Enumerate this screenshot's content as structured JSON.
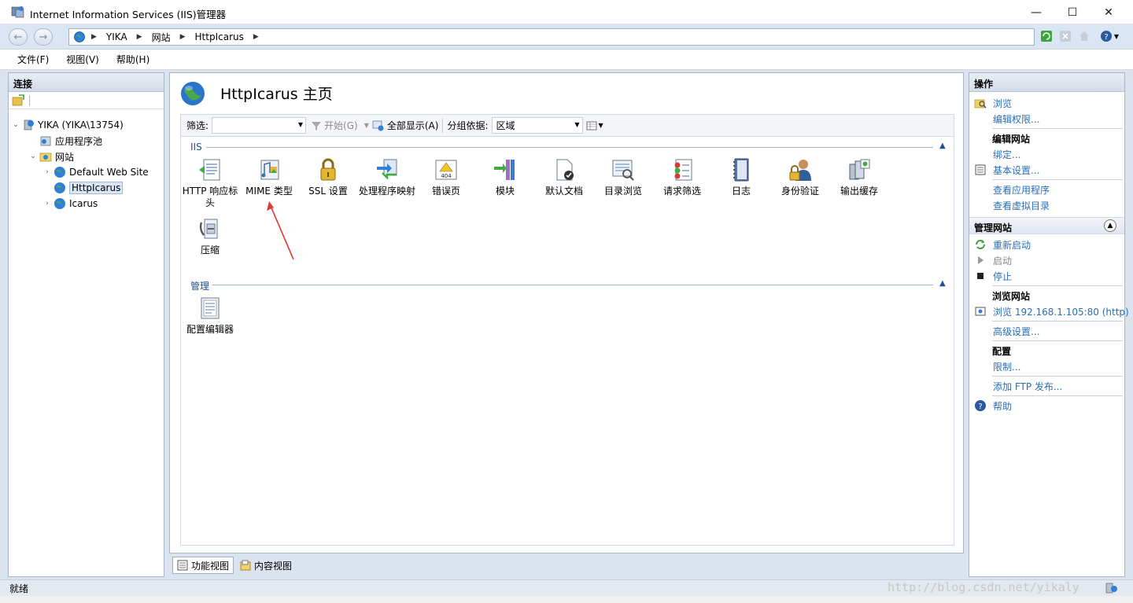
{
  "window": {
    "title": "Internet Information Services (IIS)管理器",
    "minimize": "—",
    "maximize": "☐",
    "close": "✕"
  },
  "address": {
    "crumbs": [
      "YIKA",
      "网站",
      "HttpIcarus"
    ]
  },
  "menu": [
    "文件(F)",
    "视图(V)",
    "帮助(H)"
  ],
  "connections": {
    "header": "连接",
    "tree": [
      {
        "label": "YIKA (YIKA\\13754)",
        "level": 0,
        "expander": "⌄"
      },
      {
        "label": "应用程序池",
        "level": 1,
        "expander": ""
      },
      {
        "label": "网站",
        "level": 1,
        "expander": "⌄"
      },
      {
        "label": "Default Web Site",
        "level": 2,
        "expander": "›"
      },
      {
        "label": "HttpIcarus",
        "level": 2,
        "expander": "",
        "selected": true
      },
      {
        "label": "Icarus",
        "level": 2,
        "expander": "›"
      }
    ]
  },
  "center": {
    "title": "HttpIcarus 主页",
    "filter_label": "筛选:",
    "filter_value": "",
    "start_label": "开始(G)",
    "show_all_label": "全部显示(A)",
    "group_by_label": "分组依据:",
    "group_by_value": "区域",
    "groups": [
      {
        "name": "IIS",
        "features": [
          {
            "label": "HTTP 响应标头",
            "icon": "http-response-headers-icon"
          },
          {
            "label": "MIME 类型",
            "icon": "mime-types-icon"
          },
          {
            "label": "SSL 设置",
            "icon": "ssl-lock-icon"
          },
          {
            "label": "处理程序映射",
            "icon": "handler-mappings-icon"
          },
          {
            "label": "错误页",
            "icon": "error-pages-404-icon"
          },
          {
            "label": "模块",
            "icon": "modules-icon"
          },
          {
            "label": "默认文档",
            "icon": "default-document-icon"
          },
          {
            "label": "目录浏览",
            "icon": "directory-browsing-icon"
          },
          {
            "label": "请求筛选",
            "icon": "request-filtering-icon"
          },
          {
            "label": "日志",
            "icon": "logging-icon"
          },
          {
            "label": "身份验证",
            "icon": "authentication-icon"
          },
          {
            "label": "输出缓存",
            "icon": "output-caching-icon"
          },
          {
            "label": "压缩",
            "icon": "compression-icon"
          }
        ]
      },
      {
        "name": "管理",
        "features": [
          {
            "label": "配置编辑器",
            "icon": "configuration-editor-icon"
          }
        ]
      }
    ],
    "tabs": [
      {
        "label": "功能视图",
        "active": true
      },
      {
        "label": "内容视图",
        "active": false
      }
    ]
  },
  "actions": {
    "header": "操作",
    "browse": "浏览",
    "edit_permissions": "编辑权限...",
    "edit_site_header": "编辑网站",
    "bindings": "绑定...",
    "basic_settings": "基本设置...",
    "view_applications": "查看应用程序",
    "view_virtual_dirs": "查看虚拟目录",
    "manage_site_header": "管理网站",
    "restart": "重新启动",
    "start": "启动",
    "stop": "停止",
    "browse_site_header": "浏览网站",
    "browse_url": "浏览 192.168.1.105:80 (http)",
    "advanced_settings": "高级设置...",
    "config_header": "配置",
    "limits": "限制...",
    "add_ftp": "添加 FTP 发布...",
    "help": "帮助"
  },
  "status": {
    "text": "就绪",
    "watermark": "http://blog.csdn.net/yikaly"
  },
  "colors": {
    "link": "#2a6fb8",
    "group_header": "#1f4f8f",
    "arrow": "#e03a3a"
  }
}
